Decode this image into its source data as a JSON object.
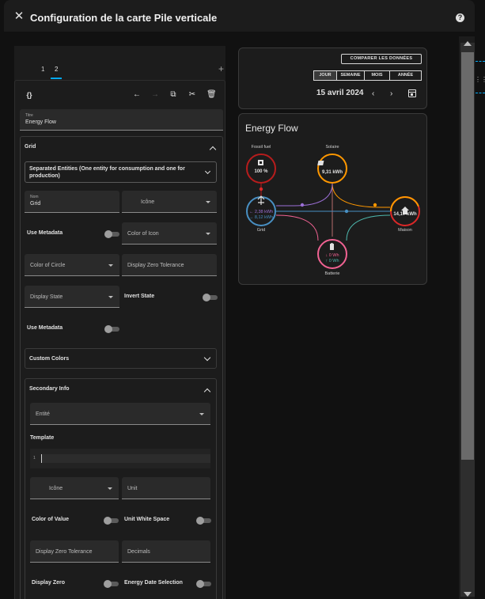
{
  "dialog": {
    "title": "Configuration de la carte Pile verticale"
  },
  "tabs": [
    {
      "label": "1"
    },
    {
      "label": "2"
    }
  ],
  "editor": {
    "title_field": {
      "label": "Titre",
      "value": "Energy Flow"
    },
    "grid": {
      "title": "Grid",
      "mode_select": "Separated Entities (One entity for consumption and one for production)",
      "name_field": {
        "label": "Nom",
        "value": "Grid"
      },
      "icon_select": "Icône",
      "use_metadata": "Use Metadata",
      "color_of_icon": "Color of Icon",
      "color_of_circle": "Color of Circle",
      "display_zero_tolerance": "Display Zero Tolerance",
      "display_state": "Display State",
      "invert_state": "Invert State",
      "use_metadata_2": "Use Metadata",
      "custom_colors": "Custom Colors",
      "secondary_info": {
        "title": "Secondary Info",
        "entity_select": "Entité",
        "template_label": "Template",
        "template_line_number": "1",
        "icon_select": "Icône",
        "unit": "Unit",
        "color_of_value": "Color of Value",
        "unit_white_space": "Unit White Space",
        "display_zero_tolerance": "Display Zero Tolerance",
        "decimals": "Decimals",
        "display_zero": "Display Zero",
        "energy_date_selection": "Energy Date Selection"
      }
    }
  },
  "preview": {
    "date_card": {
      "compare_label": "COMPARER LES DONNÉES",
      "periods": [
        "JOUR",
        "SEMAINE",
        "MOIS",
        "ANNÉE"
      ],
      "date": "15 avril 2024"
    },
    "energy_flow": {
      "title": "Energy Flow",
      "fossil": {
        "label": "Fossil fuel",
        "value": "100 %"
      },
      "solar": {
        "label": "Solaire",
        "value": "9,31 kWh"
      },
      "grid": {
        "label": "Grid",
        "in_value": "← 2,38 kWh",
        "out_value": "→ 8,12 kWh"
      },
      "home": {
        "label": "Maison",
        "value": "14,17 kWh"
      },
      "battery": {
        "label": "Batterie",
        "in_value": "↓ 0 Wh",
        "out_value": "↑ 0 Wh"
      }
    }
  },
  "colors": {
    "accent": "#03a9f4",
    "grid": "#488fc2",
    "solar": "#ff9800",
    "home": "#db2828",
    "battery": "#f06292",
    "battery_out": "#4db6ac",
    "fossil": "#b71c1c",
    "grid_to_home_purple": "#9c6fd6"
  }
}
